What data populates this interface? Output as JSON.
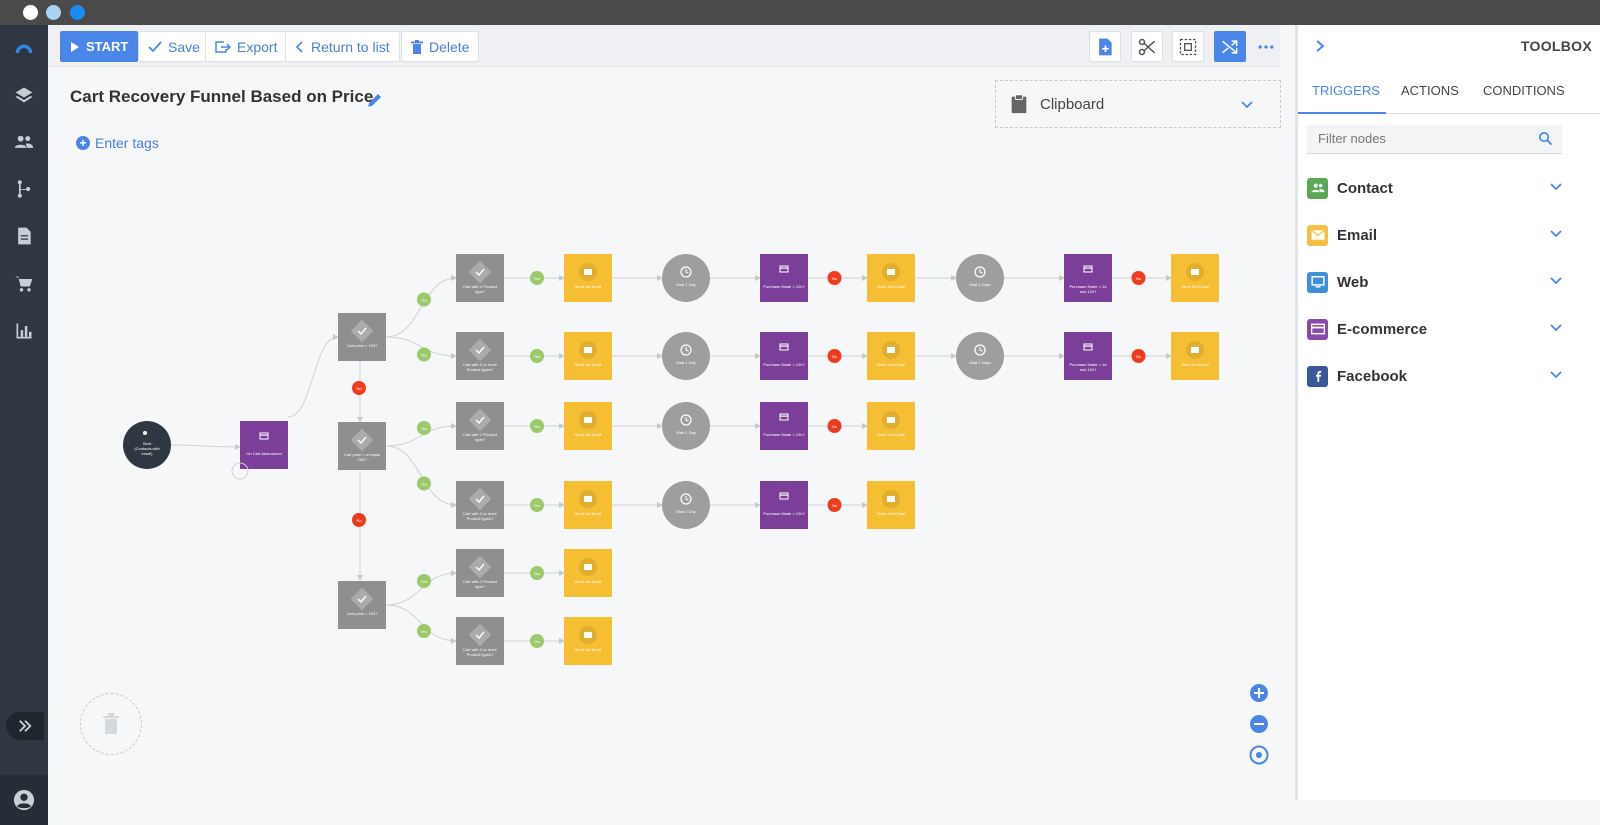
{
  "window": {
    "dots": [
      "#ffffff",
      "#a8d4f5",
      "#1a8cf0"
    ]
  },
  "toolbar": {
    "start_label": "START",
    "save_label": "Save",
    "export_label": "Export",
    "return_label": "Return to list",
    "delete_label": "Delete"
  },
  "canvas": {
    "title": "Cart Recovery Funnel Based on Price",
    "tags_label": "Enter tags",
    "clipboard_label": "Clipboard"
  },
  "toolbox": {
    "title": "TOOLBOX",
    "tabs": [
      {
        "label": "TRIGGERS",
        "active": true
      },
      {
        "label": "ACTIONS",
        "active": false
      },
      {
        "label": "CONDITIONS",
        "active": false
      }
    ],
    "filter_placeholder": "Filter nodes",
    "categories": [
      {
        "label": "Contact",
        "icon": "users-icon",
        "color": "#5aa854"
      },
      {
        "label": "Email",
        "icon": "envelope-icon",
        "color": "#f4c043"
      },
      {
        "label": "Web",
        "icon": "monitor-icon",
        "color": "#3f8fd9"
      },
      {
        "label": "E-commerce",
        "icon": "card-icon",
        "color": "#8a4aa8"
      },
      {
        "label": "Facebook",
        "icon": "facebook-icon",
        "color": "#3b5998"
      }
    ]
  },
  "flow": {
    "start_label": [
      "Start",
      "(Contacts with",
      "email)"
    ],
    "trigger_label": "On Cart Abandoned",
    "yes_label": "Yes",
    "no_label": "No",
    "cond_price_1": "Cart price > 100?",
    "cond_price_2": [
      "Cart price > or equal",
      "100?"
    ],
    "cond_price_3": "Cart price < 100?",
    "cond_product_1": [
      "Cart with 1 Product",
      "type?"
    ],
    "cond_product_2": [
      "Cart with 2 or more",
      "Product types?"
    ],
    "email_1": "Send 1st Email",
    "email_2": "Send 2nd Email",
    "email_3": "Send 3rd Email",
    "wait_1": "Wait 1 Day",
    "wait_2": "Wait 2 Days",
    "purchase_1": "Purchase Made < 12h?",
    "purchase_2": [
      "Purchase Made < 1d",
      "and 12h?"
    ],
    "colors": {
      "condition": "#8f8f8f",
      "email": "#f5be33",
      "wait": "#9e9e9e",
      "purchase": "#7b3f9a",
      "yes": "#9cc96b",
      "no": "#f03c1e",
      "start": "#2f3742"
    }
  },
  "colors": {
    "accent": "#4a86e8",
    "nav": "#2f3742"
  }
}
